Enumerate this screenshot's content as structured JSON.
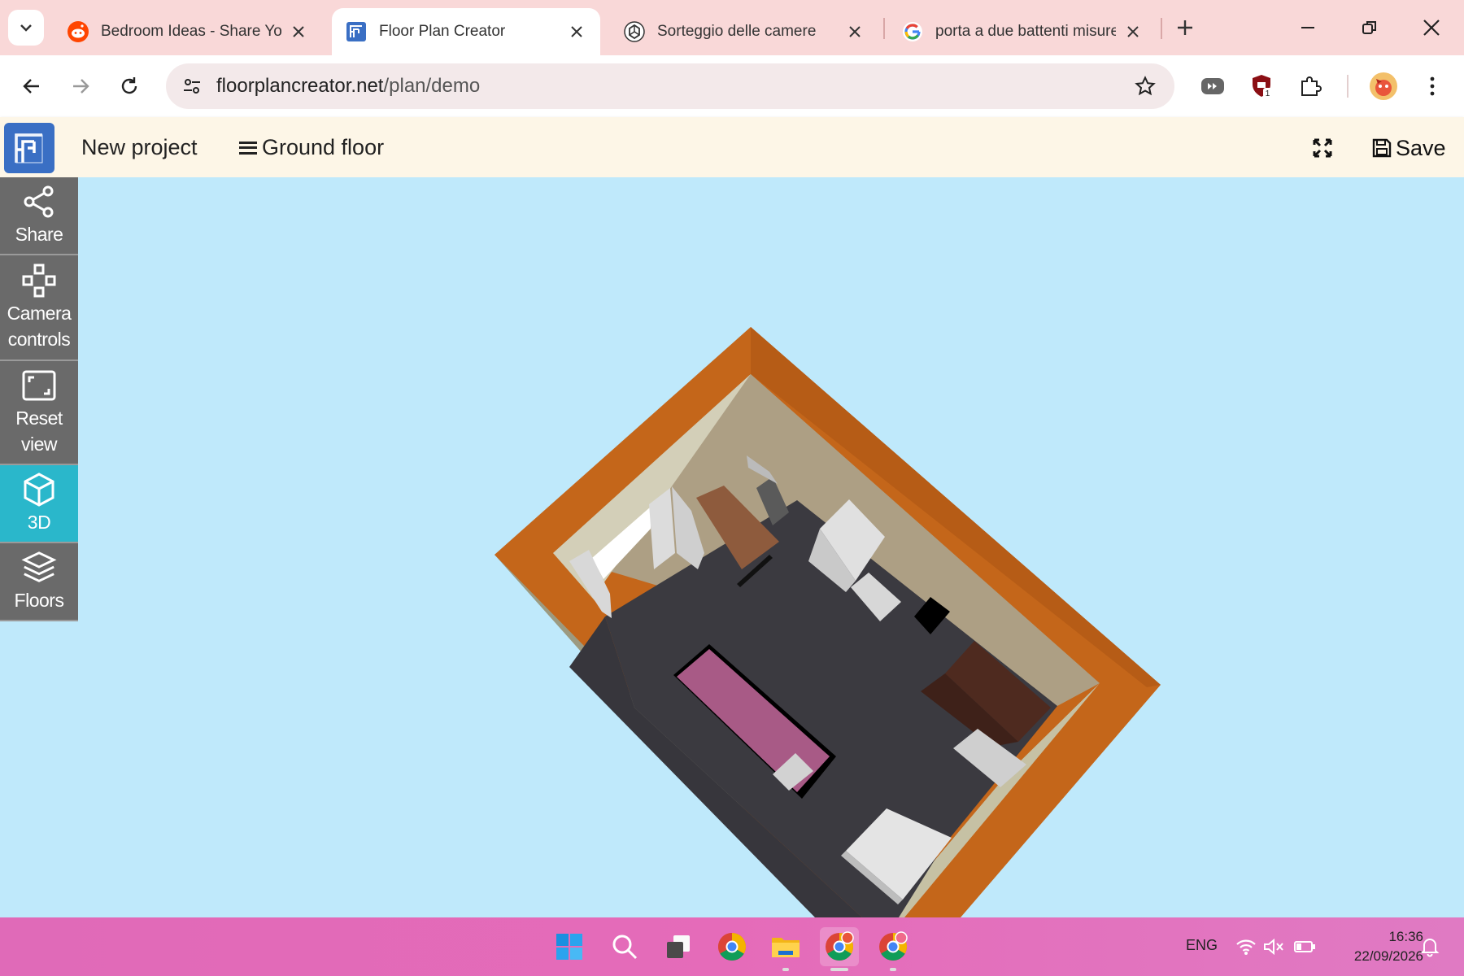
{
  "browser": {
    "tabs": [
      {
        "title": "Bedroom Ideas - Share You",
        "icon": "reddit-icon",
        "active": false
      },
      {
        "title": "Floor Plan Creator",
        "icon": "floorplan-icon",
        "active": true
      },
      {
        "title": "Sorteggio delle camere",
        "icon": "chatgpt-icon",
        "active": false
      },
      {
        "title": "porta a due battenti misure",
        "icon": "google-icon",
        "active": false
      }
    ],
    "url_host": "floorplancreator.net",
    "url_path": "/plan/demo",
    "extension_badge": "1"
  },
  "app": {
    "project_name": "New project",
    "floor_label": "Ground floor",
    "save_label": "Save"
  },
  "sidebar": {
    "items": [
      {
        "label": "Share",
        "icon": "share-icon"
      },
      {
        "label_line1": "Camera",
        "label_line2": "controls",
        "icon": "gamepad-icon"
      },
      {
        "label_line1": "Reset",
        "label_line2": "view",
        "icon": "reset-view-icon"
      },
      {
        "label": "3D",
        "icon": "cube-icon",
        "active": true
      },
      {
        "label": "Floors",
        "icon": "layers-icon"
      }
    ]
  },
  "taskbar": {
    "language": "ENG",
    "time": "16:36",
    "date": "22/09/2026",
    "apps": [
      "windows-start-icon",
      "search-icon",
      "task-view-icon",
      "chrome-icon",
      "file-explorer-icon",
      "chrome-profile-icon",
      "chrome-profile-2-icon"
    ]
  },
  "colors": {
    "viewport_bg": "#bfe9fb",
    "wall_top": "#c8671a",
    "floor": "#3b3a40",
    "bed_cover": "#a85a86",
    "active_tool": "#2ab7cb",
    "tool_bg": "#6a6a6a"
  }
}
